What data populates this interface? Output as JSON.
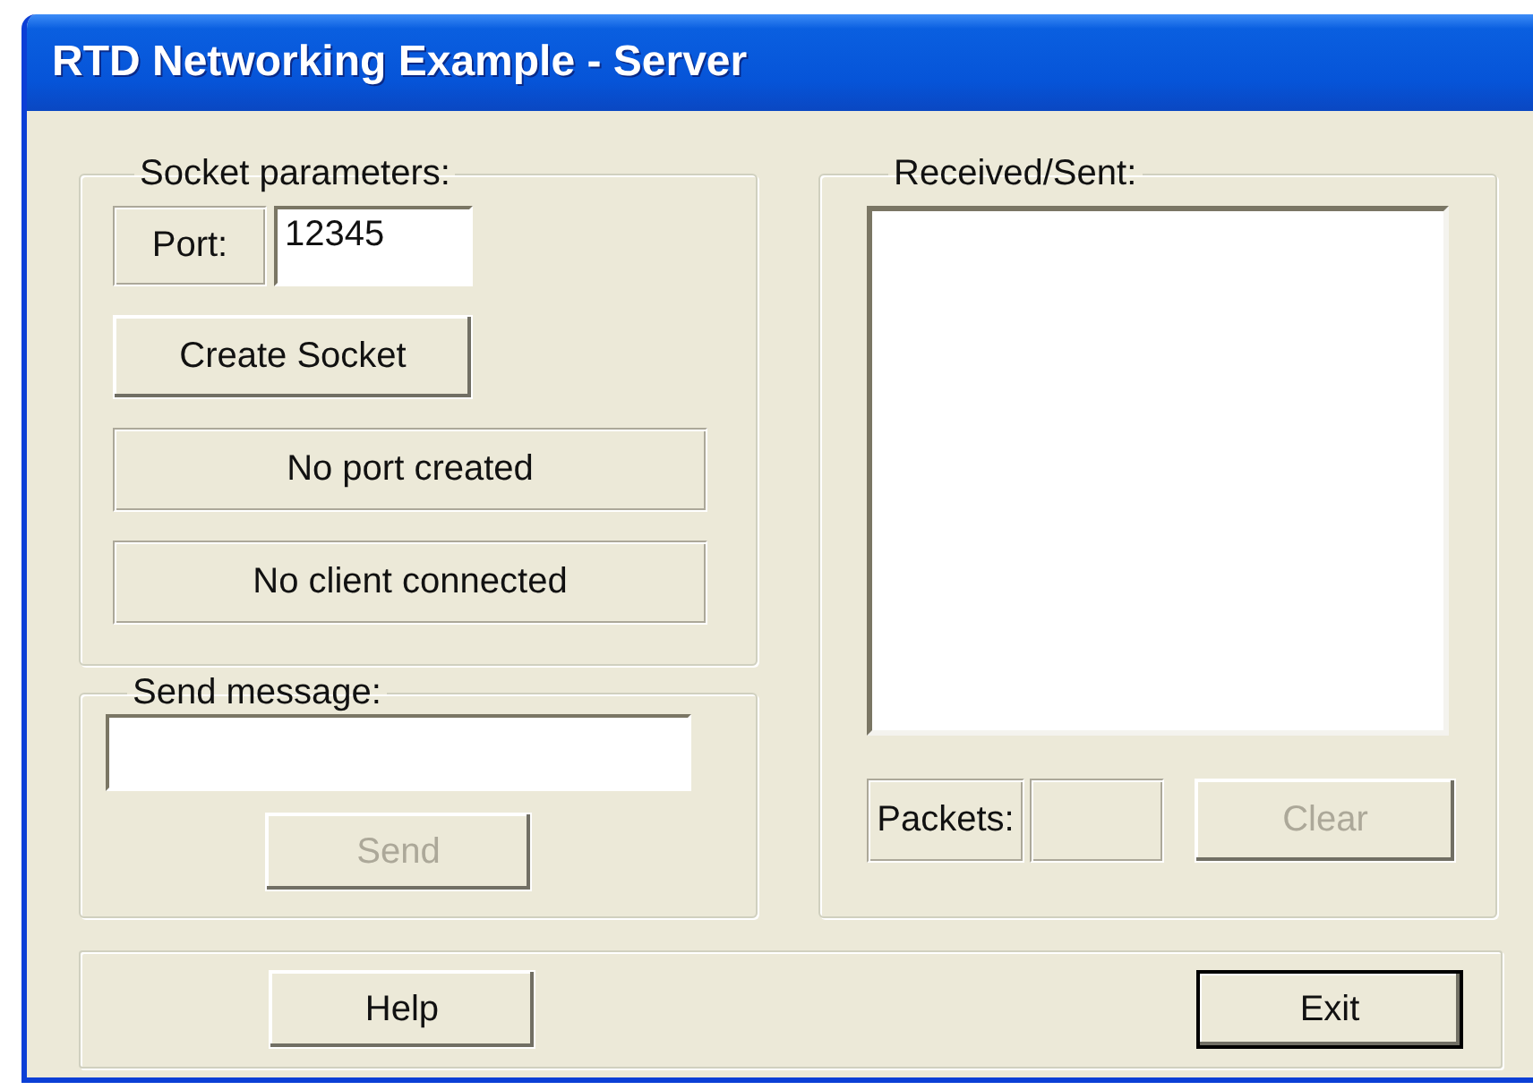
{
  "window": {
    "title": "RTD Networking Example - Server"
  },
  "socket_parameters": {
    "title": "Socket parameters:",
    "port_label": "Port:",
    "port_value": "12345",
    "create_button": {
      "label": "Create Socket",
      "disabled": false
    },
    "status": [
      "No port created",
      "No client connected"
    ]
  },
  "send_message": {
    "title": "Send message:",
    "send_button": {
      "label": "Send",
      "disabled": true
    }
  },
  "received_sent": {
    "title": "Received/Sent:",
    "packets_label": "Packets:",
    "clear_button": {
      "label": "Clear",
      "disabled": true
    }
  },
  "buttons": [
    {
      "label": "Help",
      "default": false
    },
    {
      "label": "Exit",
      "default": true
    }
  ]
}
